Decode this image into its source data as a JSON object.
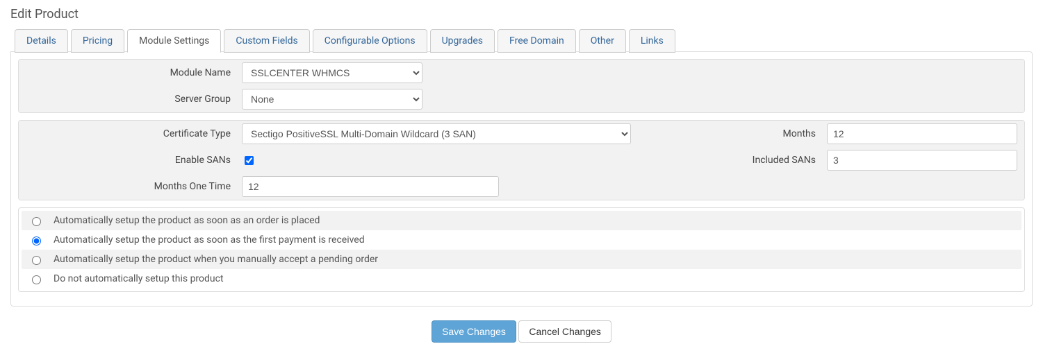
{
  "page": {
    "title": "Edit Product"
  },
  "tabs": {
    "details": "Details",
    "pricing": "Pricing",
    "module_settings": "Module Settings",
    "custom_fields": "Custom Fields",
    "configurable_options": "Configurable Options",
    "upgrades": "Upgrades",
    "free_domain": "Free Domain",
    "other": "Other",
    "links": "Links"
  },
  "module": {
    "name_label": "Module Name",
    "name_value": "SSLCENTER WHMCS",
    "server_group_label": "Server Group",
    "server_group_value": "None"
  },
  "settings": {
    "cert_type_label": "Certificate Type",
    "cert_type_value": "Sectigo PositiveSSL Multi-Domain Wildcard (3 SAN)",
    "months_label": "Months",
    "months_value": "12",
    "enable_sans_label": "Enable SANs",
    "enable_sans_checked": true,
    "included_sans_label": "Included SANs",
    "included_sans_value": "3",
    "months_one_time_label": "Months One Time",
    "months_one_time_value": "12"
  },
  "autosetup": {
    "opt1": "Automatically setup the product as soon as an order is placed",
    "opt2": "Automatically setup the product as soon as the first payment is received",
    "opt3": "Automatically setup the product when you manually accept a pending order",
    "opt4": "Do not automatically setup this product",
    "selected": "opt2"
  },
  "buttons": {
    "save": "Save Changes",
    "cancel": "Cancel Changes"
  }
}
